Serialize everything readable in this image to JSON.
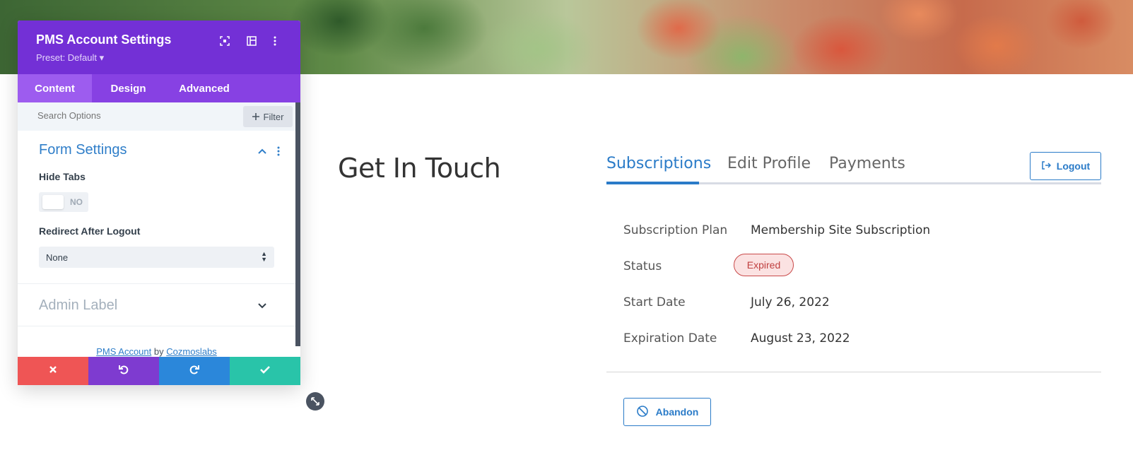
{
  "hero": {
    "image": "fresh-vegetables-banner"
  },
  "page": {
    "heading": "Get In Touch"
  },
  "account": {
    "tabs": [
      {
        "label": "Subscriptions",
        "active": true
      },
      {
        "label": "Edit Profile",
        "active": false
      },
      {
        "label": "Payments",
        "active": false
      }
    ],
    "logout_label": "Logout",
    "rows": [
      {
        "label": "Subscription Plan",
        "value": "Membership Site Subscription"
      },
      {
        "label": "Status",
        "value": "Expired"
      },
      {
        "label": "Start Date",
        "value": "July 26, 2022"
      },
      {
        "label": "Expiration Date",
        "value": "August 23, 2022"
      }
    ],
    "abandon_label": "Abandon",
    "colors": {
      "accent": "#2a7bc8",
      "expired_bg": "#fbe2e2",
      "expired_text": "#c04040"
    }
  },
  "panel": {
    "title": "PMS Account Settings",
    "preset": "Preset: Default ▾",
    "tabs": [
      {
        "label": "Content",
        "active": true
      },
      {
        "label": "Design",
        "active": false
      },
      {
        "label": "Advanced",
        "active": false
      }
    ],
    "search_placeholder": "Search Options",
    "filter_label": "Filter",
    "sections": {
      "form_settings": "Form Settings",
      "admin_label": "Admin Label"
    },
    "fields": {
      "hide_tabs_label": "Hide Tabs",
      "hide_tabs_value": "NO",
      "redirect_label": "Redirect After Logout",
      "redirect_value": "None"
    },
    "credit": {
      "plugin": "PMS Account",
      "by": "by",
      "author": "Cozmoslabs"
    },
    "colors": {
      "header": "#7330d6",
      "tabs": "#8741e3",
      "cancel": "#ef5555",
      "undo": "#7e3bd0",
      "redo": "#2b87da",
      "save": "#29c4a9"
    }
  }
}
